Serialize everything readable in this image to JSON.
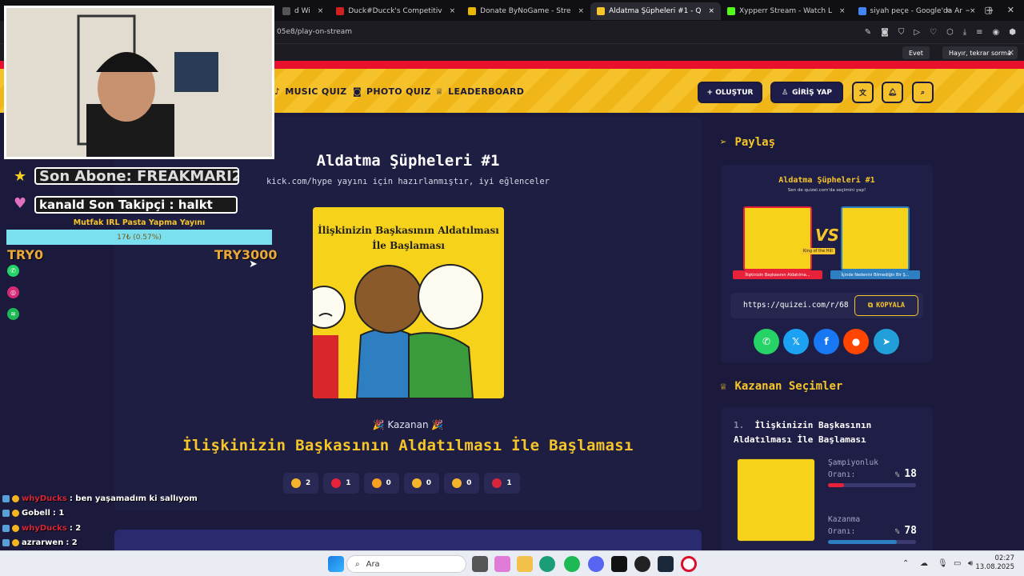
{
  "browser": {
    "tabs": [
      {
        "label": "d Wi",
        "color": "#555555"
      },
      {
        "label": "Duck#Ducck's Competitiv",
        "color": "#d02020"
      },
      {
        "label": "Donate ByNoGame - Stre",
        "color": "#e8b800"
      },
      {
        "label": "Aldatma Şüpheleri #1 - Q",
        "color": "#f5c52a",
        "active": true
      },
      {
        "label": "Xypperr Stream - Watch L",
        "color": "#53fc18"
      },
      {
        "label": "siyah peçe - Google'da Ar",
        "color": "#4285f4"
      }
    ],
    "url": "05e8/play-on-stream",
    "notif": {
      "yes": "Evet",
      "no": "Hayır, tekrar sorma",
      "close": "×"
    }
  },
  "site": {
    "nav": [
      {
        "label": "MUSIC QUIZ",
        "icon": "music-icon"
      },
      {
        "label": "PHOTO QUIZ",
        "icon": "camera-icon"
      },
      {
        "label": "LEADERBOARD",
        "icon": "trophy-icon"
      }
    ],
    "create_btn": "+ OLUŞTUR",
    "login_btn": "GİRİŞ YAP"
  },
  "quiz": {
    "title": "Aldatma Şüpheleri #1",
    "subtitle": "kick.com/hype yayını için hazırlanmıştır, iyi eğlenceler",
    "image_caption": "İlişkinizin Başkasının Aldatılması İle Başlaması",
    "winner_label": "Kazanan",
    "winner": "İlişkinizin Başkasının Aldatılması İle Başlaması",
    "reactions": [
      {
        "name": "thumbs-up",
        "count": "2",
        "color": "#f5b52a"
      },
      {
        "name": "heart",
        "count": "1",
        "color": "#e8213a"
      },
      {
        "name": "laugh",
        "count": "0",
        "color": "#f5a020"
      },
      {
        "name": "wow",
        "count": "0",
        "color": "#f5b52a"
      },
      {
        "name": "sad",
        "count": "0",
        "color": "#f5b52a"
      },
      {
        "name": "angry",
        "count": "1",
        "color": "#d8253a"
      }
    ]
  },
  "share": {
    "heading": "Paylaş",
    "card_title": "Aldatma Şüpheleri #1",
    "card_sub": "Sen de quizei.com'da seçimini yap!",
    "left_caption": "İlişkinizin Başkasının Aldatılma...",
    "right_caption": "İçinde Nedenini Bilmediğin Bir Ş...",
    "link": "https://quizei.com/r/68",
    "copy_btn": "KOPYALA",
    "vs": "VS",
    "king": "King of the Hill"
  },
  "results": {
    "heading": "Kazanan Seçimler",
    "item_rank": "1.",
    "item_title": "İlişkinizin Başkasının Aldatılması İle Başlaması",
    "champ_label": "Şampiyonluk Oranı:",
    "champ_value": "18",
    "champ_pct": 18,
    "win_label": "Kazanma Oranı:",
    "win_value": "78",
    "win_pct": 78,
    "pct_sign": "%"
  },
  "stream": {
    "last_sub": "Son Abone: FREAKMARI2",
    "last_follow": "kanald    Son Takipçi : halkt",
    "goal_title": "Mutfak IRL Pasta Yapma Yayını",
    "goal_progress": "17₺ (0.57%)",
    "goal_pct": 0.57,
    "goal_start": "TRY0",
    "goal_end": "TRY3000",
    "chat": [
      {
        "user": "whyDucks",
        "msg": ": ben yaşamadım ki sallıyom",
        "color": "#d8253a"
      },
      {
        "user": "Gobell",
        "msg": ": 1",
        "color": "#ffffff"
      },
      {
        "user": "whyDucks",
        "msg": ": 2",
        "color": "#d8253a"
      },
      {
        "user": "azrarwen",
        "msg": ": 2",
        "color": "#ffffff"
      }
    ]
  },
  "taskbar": {
    "search": "Ara",
    "time": "02:27",
    "date": "13.08.2025"
  }
}
